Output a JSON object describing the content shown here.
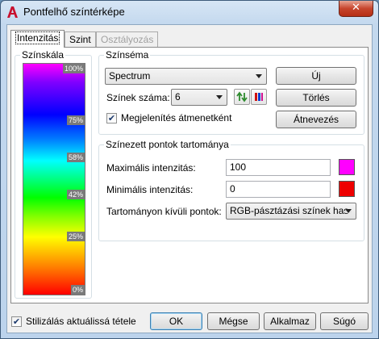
{
  "window": {
    "title": "Pontfelhő színtérképe",
    "close_glyph": "✕"
  },
  "tabs": [
    {
      "label": "Intenzitás",
      "state": "active"
    },
    {
      "label": "Szint",
      "state": "normal"
    },
    {
      "label": "Osztályozás",
      "state": "disabled"
    }
  ],
  "scale": {
    "title": "Színskála",
    "labels": [
      "100%",
      "75%",
      "58%",
      "42%",
      "25%",
      "0%"
    ]
  },
  "scheme": {
    "title": "Színséma",
    "selected": "Spectrum",
    "count_label": "Színek száma:",
    "count_value": "6",
    "show_gradient_label": "Megjelenítés átmenetként",
    "show_gradient_checked": true,
    "new_button": "Új",
    "delete_button": "Törlés",
    "rename_button": "Átnevezés"
  },
  "range": {
    "title": "Színezett pontok tartománya",
    "max_label": "Maximális intenzitás:",
    "max_value": "100",
    "max_color": "#ff00ff",
    "min_label": "Minimális intenzitás:",
    "min_value": "0",
    "min_color": "#ee0000",
    "outside_label": "Tartományon kívüli pontok:",
    "outside_value": "RGB-pásztázási színek has"
  },
  "footer": {
    "update_style_label": "Stilizálás aktuálissá tétele",
    "update_style_checked": true,
    "ok": "OK",
    "cancel": "Mégse",
    "apply": "Alkalmaz",
    "help": "Súgó"
  },
  "colors": {
    "accent": "#3c7fb1",
    "app_icon": "#c8102e"
  }
}
